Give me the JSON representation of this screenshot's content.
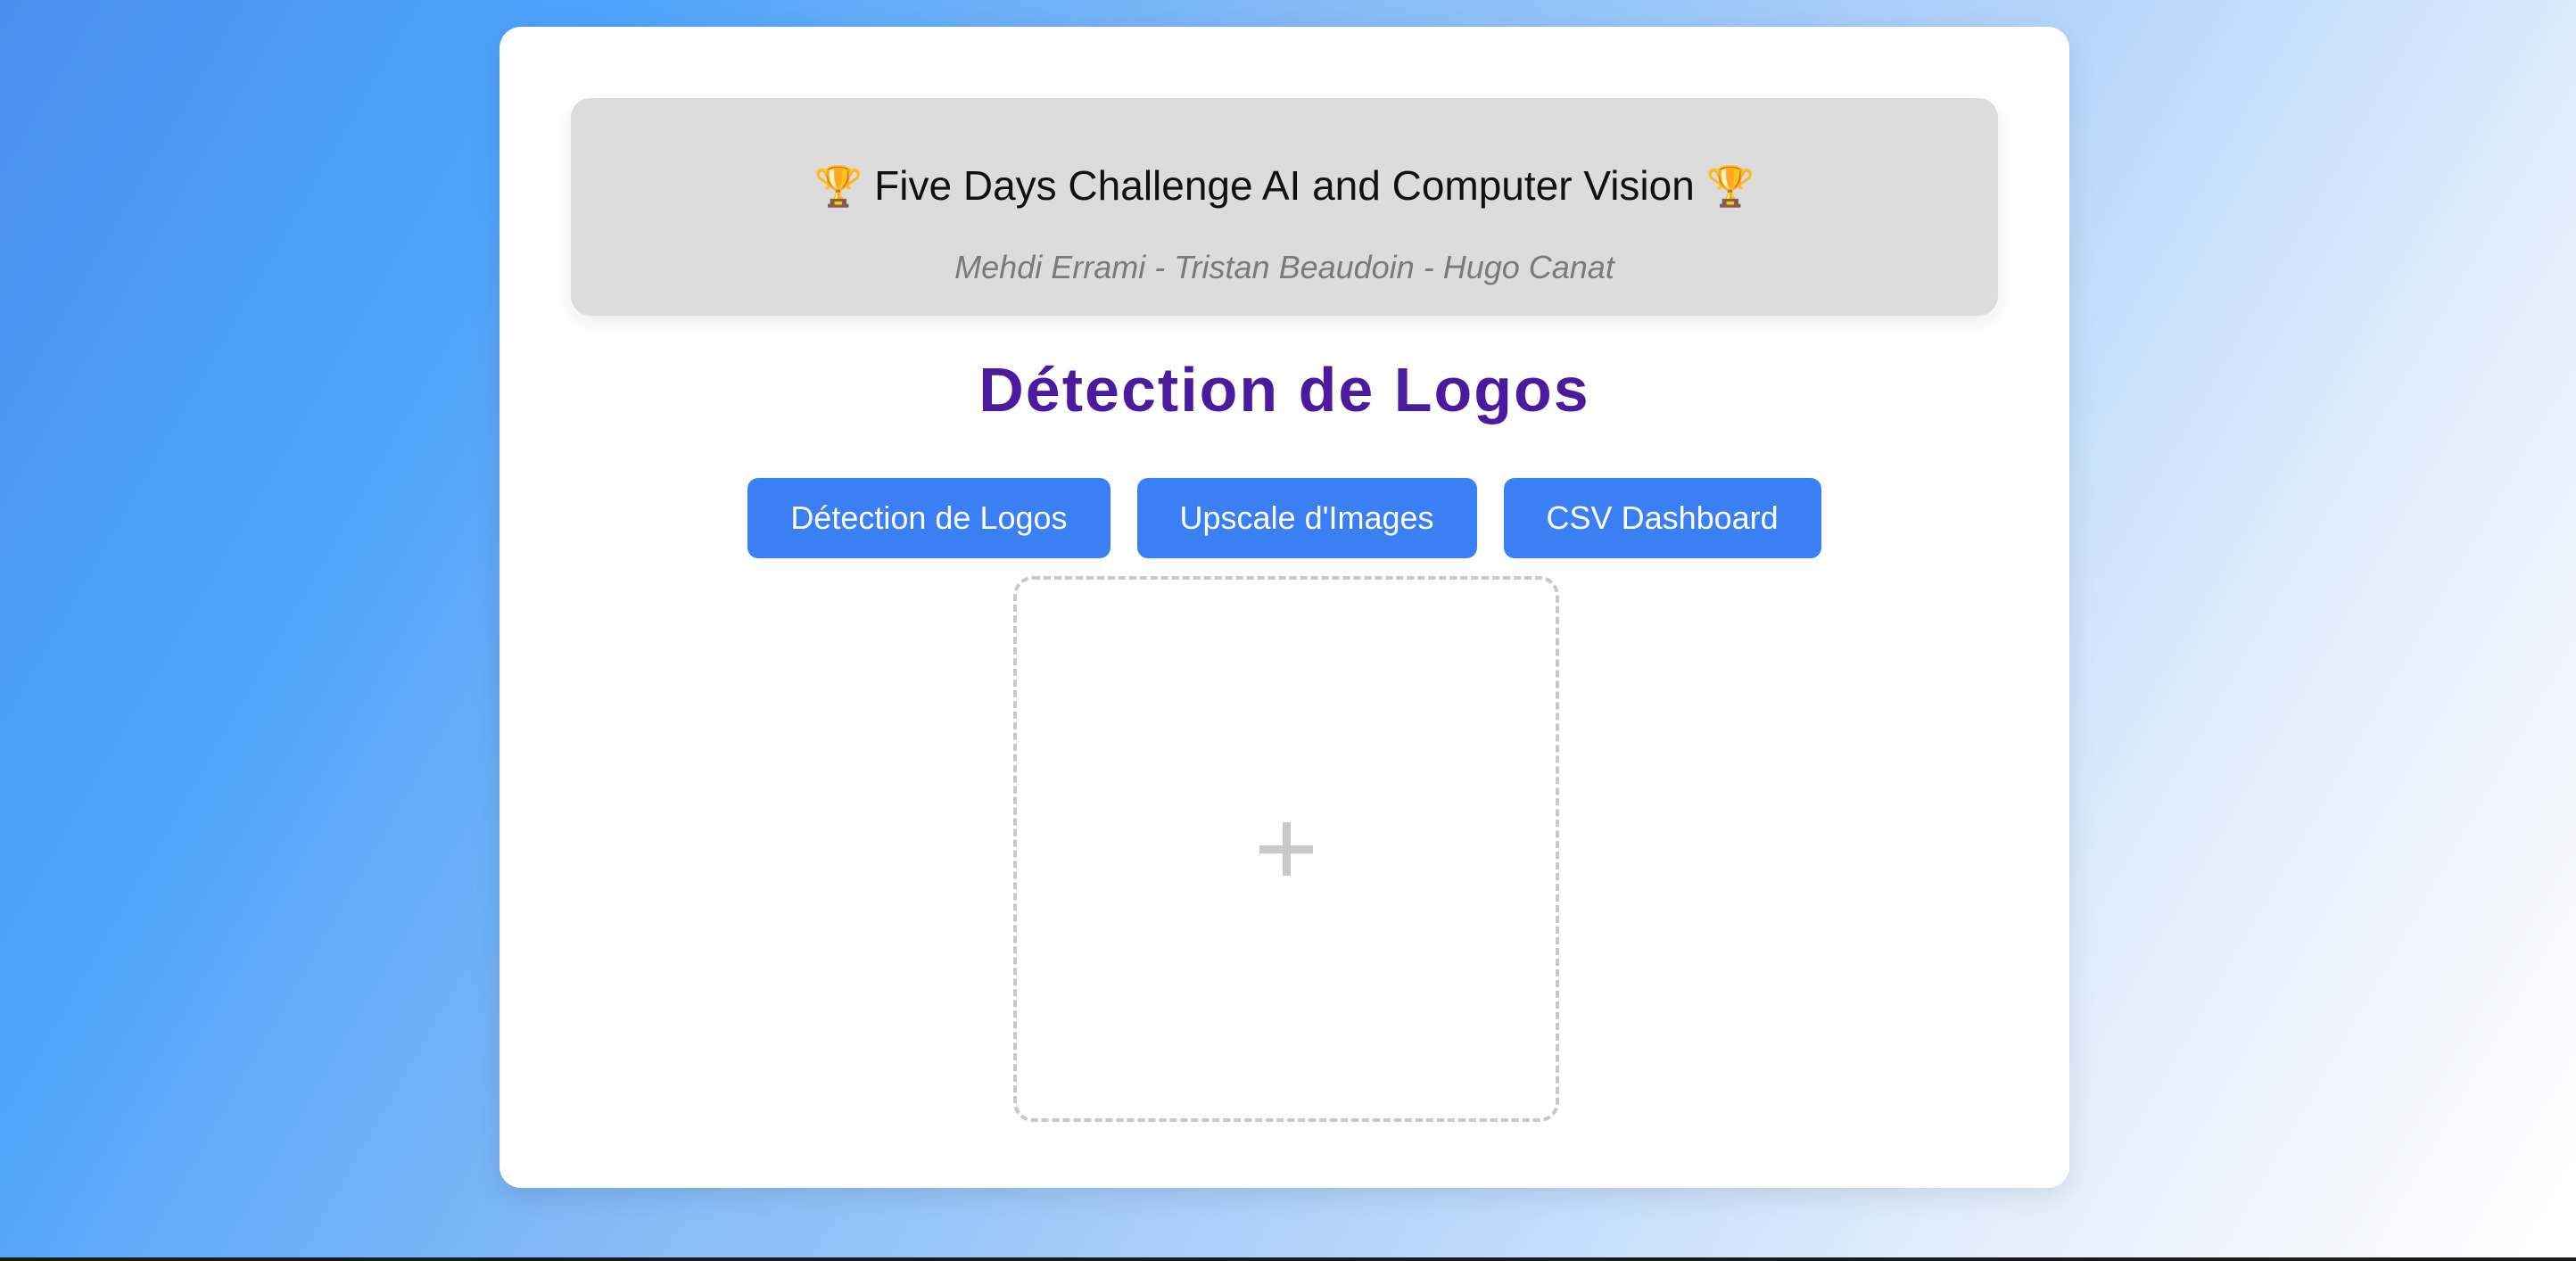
{
  "banner": {
    "trophy_left": "🏆",
    "title": "Five Days Challenge AI and Computer Vision",
    "trophy_right": "🏆",
    "authors": "Mehdi Errami - Tristan Beaudoin - Hugo Canat"
  },
  "page": {
    "title": "Détection de Logos"
  },
  "nav": {
    "buttons": [
      {
        "label": "Détection de Logos"
      },
      {
        "label": "Upscale d'Images"
      },
      {
        "label": "CSV Dashboard"
      }
    ]
  },
  "upload": {
    "icon": "plus-icon"
  },
  "colors": {
    "accent_button": "#3b7ff5",
    "title_purple": "#4b1a9f",
    "banner_bg": "#dcdcdc",
    "dropzone_border": "#c8c8c8"
  }
}
